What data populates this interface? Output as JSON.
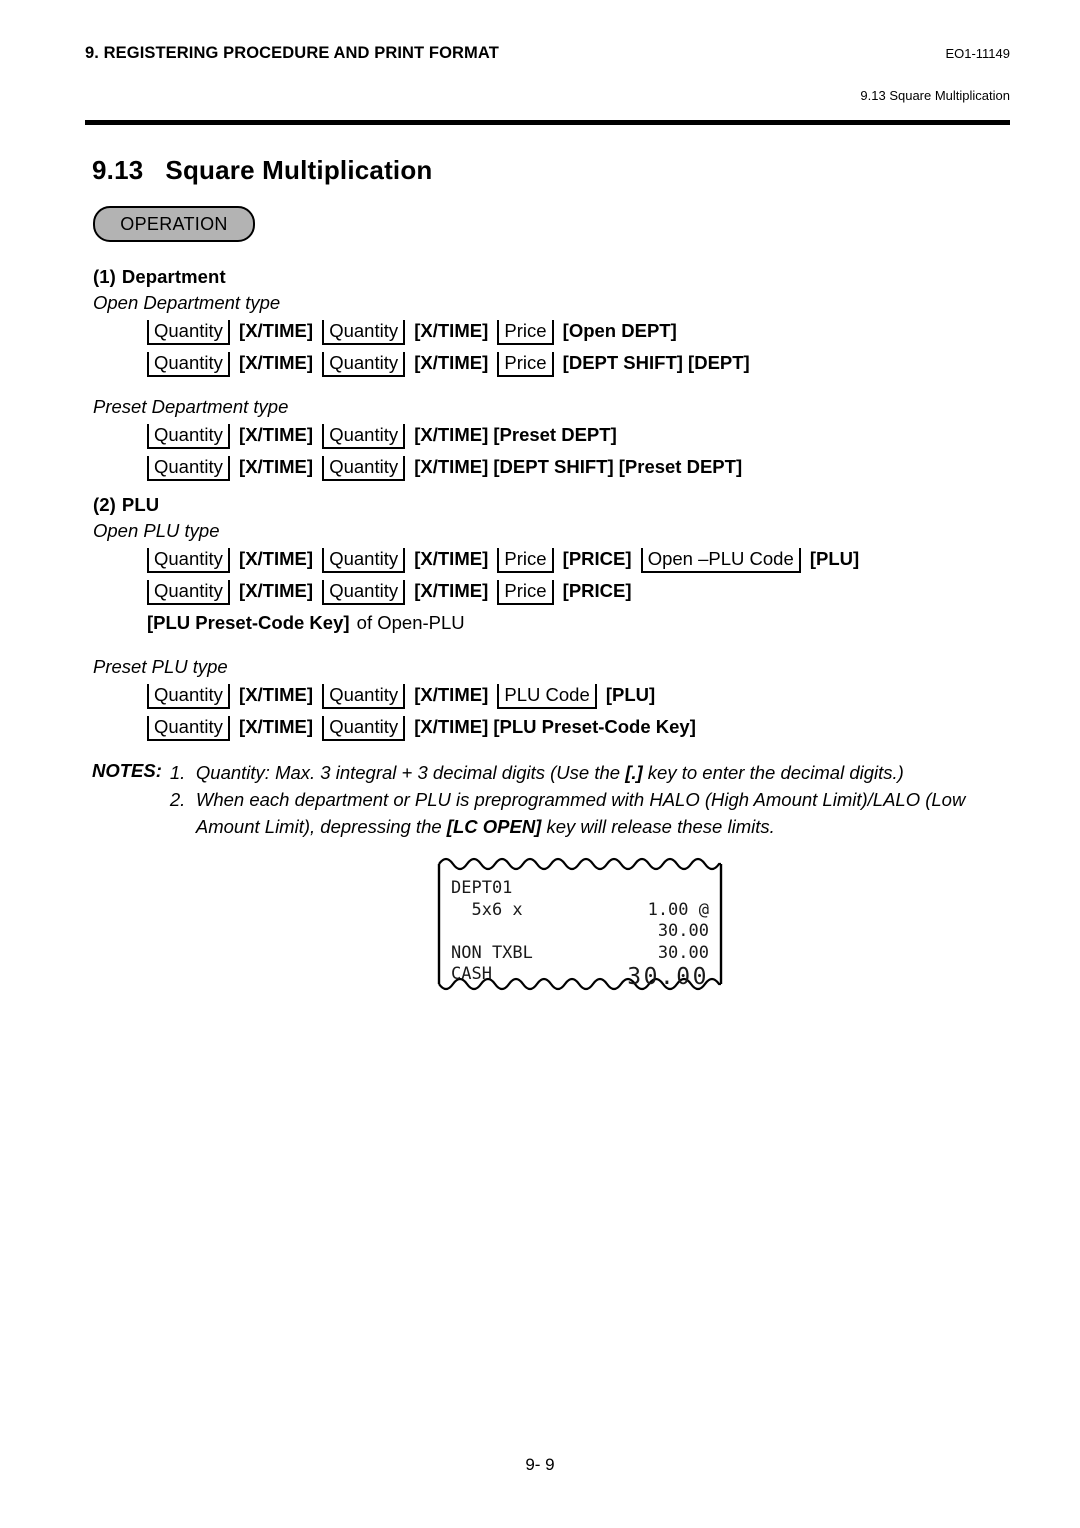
{
  "header": {
    "chapter": "9. REGISTERING PROCEDURE AND PRINT FORMAT",
    "doc_code": "EO1-11149",
    "running_head": "9.13 Square Multiplication"
  },
  "section": {
    "number": "9.13",
    "title": "Square Multiplication",
    "badge": "OPERATION"
  },
  "groups": [
    {
      "index": "(1)",
      "name": "Department",
      "types": [
        {
          "label": "Open Department type",
          "sequences": [
            {
              "tokens": [
                {
                  "kind": "operand",
                  "text": "Quantity"
                },
                {
                  "kind": "key",
                  "text": "[X/TIME]"
                },
                {
                  "kind": "operand",
                  "text": "Quantity"
                },
                {
                  "kind": "key",
                  "text": "[X/TIME]"
                },
                {
                  "kind": "operand",
                  "text": "Price"
                },
                {
                  "kind": "key",
                  "text": "[Open DEPT]"
                }
              ]
            },
            {
              "tokens": [
                {
                  "kind": "operand",
                  "text": "Quantity"
                },
                {
                  "kind": "key",
                  "text": "[X/TIME]"
                },
                {
                  "kind": "operand",
                  "text": "Quantity"
                },
                {
                  "kind": "key",
                  "text": "[X/TIME]"
                },
                {
                  "kind": "operand",
                  "text": "Price"
                },
                {
                  "kind": "key",
                  "text": "[DEPT SHIFT] [DEPT]"
                }
              ]
            }
          ]
        },
        {
          "label": "Preset Department type",
          "sequences": [
            {
              "tokens": [
                {
                  "kind": "operand",
                  "text": "Quantity"
                },
                {
                  "kind": "key",
                  "text": "[X/TIME]"
                },
                {
                  "kind": "operand",
                  "text": "Quantity"
                },
                {
                  "kind": "key",
                  "text": "[X/TIME] [Preset DEPT]"
                }
              ]
            },
            {
              "tokens": [
                {
                  "kind": "operand",
                  "text": "Quantity"
                },
                {
                  "kind": "key",
                  "text": "[X/TIME]"
                },
                {
                  "kind": "operand",
                  "text": "Quantity"
                },
                {
                  "kind": "key",
                  "text": "[X/TIME] [DEPT SHIFT] [Preset DEPT]"
                }
              ]
            }
          ]
        }
      ]
    },
    {
      "index": "(2)",
      "name": "PLU",
      "types": [
        {
          "label": "Open PLU type",
          "sequences": [
            {
              "tokens": [
                {
                  "kind": "operand",
                  "text": "Quantity"
                },
                {
                  "kind": "key",
                  "text": "[X/TIME]"
                },
                {
                  "kind": "operand",
                  "text": "Quantity"
                },
                {
                  "kind": "key",
                  "text": "[X/TIME]"
                },
                {
                  "kind": "operand",
                  "text": "Price"
                },
                {
                  "kind": "key",
                  "text": "[PRICE]"
                },
                {
                  "kind": "operand",
                  "text": "Open –PLU Code"
                },
                {
                  "kind": "key",
                  "text": "[PLU]"
                }
              ]
            },
            {
              "tokens": [
                {
                  "kind": "operand",
                  "text": "Quantity"
                },
                {
                  "kind": "key",
                  "text": "[X/TIME]"
                },
                {
                  "kind": "operand",
                  "text": "Quantity"
                },
                {
                  "kind": "key",
                  "text": "[X/TIME]"
                },
                {
                  "kind": "operand",
                  "text": "Price"
                },
                {
                  "kind": "key",
                  "text": "[PRICE]"
                }
              ],
              "continuation": [
                {
                  "kind": "key",
                  "text": "[PLU Preset-Code Key]"
                },
                {
                  "kind": "plain",
                  "text": "of Open-PLU"
                }
              ]
            }
          ]
        },
        {
          "label": "Preset PLU type",
          "sequences": [
            {
              "tokens": [
                {
                  "kind": "operand",
                  "text": "Quantity"
                },
                {
                  "kind": "key",
                  "text": "[X/TIME]"
                },
                {
                  "kind": "operand",
                  "text": "Quantity"
                },
                {
                  "kind": "key",
                  "text": "[X/TIME]"
                },
                {
                  "kind": "operand",
                  "text": "PLU Code"
                },
                {
                  "kind": "key",
                  "text": "[PLU]"
                }
              ]
            },
            {
              "tokens": [
                {
                  "kind": "operand",
                  "text": "Quantity"
                },
                {
                  "kind": "key",
                  "text": "[X/TIME]"
                },
                {
                  "kind": "operand",
                  "text": "Quantity"
                },
                {
                  "kind": "key",
                  "text": "[X/TIME] [PLU Preset-Code Key]"
                }
              ]
            }
          ]
        }
      ]
    }
  ],
  "notes": {
    "label": "NOTES:",
    "items": [
      {
        "num": "1.",
        "parts": [
          {
            "kind": "plain",
            "text": "Quantity: Max. 3 integral + 3 decimal digits (Use the "
          },
          {
            "kind": "bold",
            "text": "[.]"
          },
          {
            "kind": "plain",
            "text": " key to enter the decimal digits.)"
          }
        ]
      },
      {
        "num": "2.",
        "parts": [
          {
            "kind": "plain",
            "text": "When each department or PLU is preprogrammed with HALO (High Amount Limit)/LALO (Low"
          }
        ],
        "continuation": [
          {
            "kind": "plain",
            "text": "Amount Limit), depressing the "
          },
          {
            "kind": "bold",
            "text": "[LC OPEN]"
          },
          {
            "kind": "plain",
            "text": " key will release these limits."
          }
        ]
      }
    ]
  },
  "receipt": {
    "lines": [
      {
        "left": "DEPT01",
        "right": "",
        "style": "normal"
      },
      {
        "left": "  5x6 x",
        "right": "1.00 @",
        "style": "normal"
      },
      {
        "left": "",
        "right": "30.00",
        "style": "normal"
      },
      {
        "left": "NON TXBL",
        "right": "30.00",
        "style": "normal"
      },
      {
        "left": "CASH",
        "right": "30.00",
        "style": "wide"
      }
    ]
  },
  "footer": {
    "page": "9- 9"
  }
}
